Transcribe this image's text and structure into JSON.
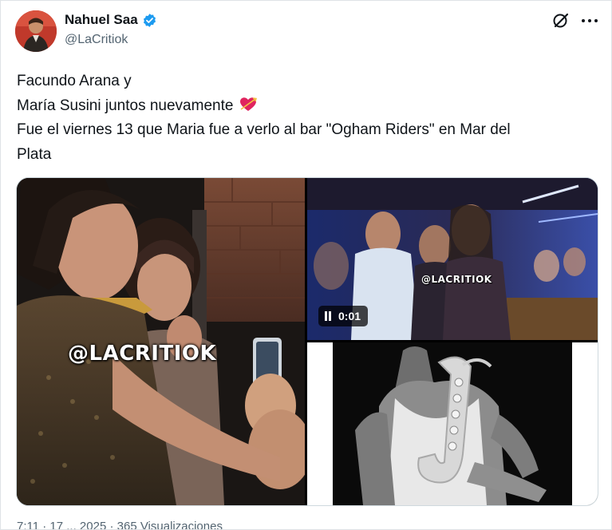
{
  "tweet": {
    "author": {
      "name": "Nahuel Saa",
      "handle": "@LaCritiok",
      "verified": true
    },
    "text_lines": [
      "Facundo Arana y",
      "María Susini juntos nuevamente",
      "Fue el viernes 13 que Maria fue a verlo al bar \"Ogham Riders\" en Mar del",
      "Plata"
    ],
    "emoji": "heart-with-arrow",
    "media": {
      "photo_left_watermark": "@LACRITIOK",
      "video_watermark": "@LACRITIOK",
      "video_time": "0:01"
    },
    "footer_partial": "7:11 · 17 ... 2025 · 365 Visualizaciones"
  },
  "colors": {
    "text": "#0f1419",
    "secondary": "#536471",
    "verified": "#1d9bf0",
    "border": "#cfd9de"
  },
  "icons": {
    "grok": "grok-icon",
    "more": "more-icon",
    "verified": "verified-badge-icon",
    "pause": "pause-icon"
  }
}
